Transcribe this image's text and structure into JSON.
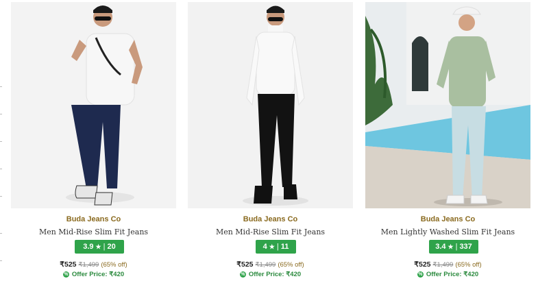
{
  "products": [
    {
      "brand": "Buda Jeans Co",
      "title": "Men Mid-Rise Slim Fit Jeans",
      "rating": "3.9",
      "star": "★",
      "separator": "|",
      "reviews": "20",
      "price": "₹525",
      "mrp": "₹1,499",
      "discount": "(65% off)",
      "offer_label": "Offer Price: ₹420",
      "offer_icon": "%",
      "image": {
        "top_color": "#f4f4f4",
        "shirt_color": "#f2f2f2",
        "pants_color": "#1e2a4f",
        "shoe_color": "#e6e6e6"
      }
    },
    {
      "brand": "Buda Jeans Co",
      "title": "Men Mid-Rise Slim Fit Jeans",
      "rating": "4",
      "star": "★",
      "separator": "|",
      "reviews": "11",
      "price": "₹525",
      "mrp": "₹1,499",
      "discount": "(65% off)",
      "offer_label": "Offer Price: ₹420",
      "offer_icon": "%",
      "image": {
        "top_color": "#f4f4f4",
        "shirt_color": "#f7f7f7",
        "pants_color": "#121212",
        "shoe_color": "#111111"
      }
    },
    {
      "brand": "Buda Jeans Co",
      "title": "Men Lightly Washed Slim Fit Jeans",
      "rating": "3.4",
      "star": "★",
      "separator": "|",
      "reviews": "337",
      "price": "₹525",
      "mrp": "₹1,499",
      "discount": "(65% off)",
      "offer_label": "Offer Price: ₹420",
      "offer_icon": "%",
      "image": {
        "top_color": "#eaeef0",
        "shirt_color": "#a9bfa0",
        "pants_color": "#c7dde3",
        "shoe_color": "#f2f2f2"
      }
    }
  ],
  "colors": {
    "rating_bg": "#2fa34a",
    "brand": "#8a6a1f",
    "offer": "#2b8a3e"
  }
}
